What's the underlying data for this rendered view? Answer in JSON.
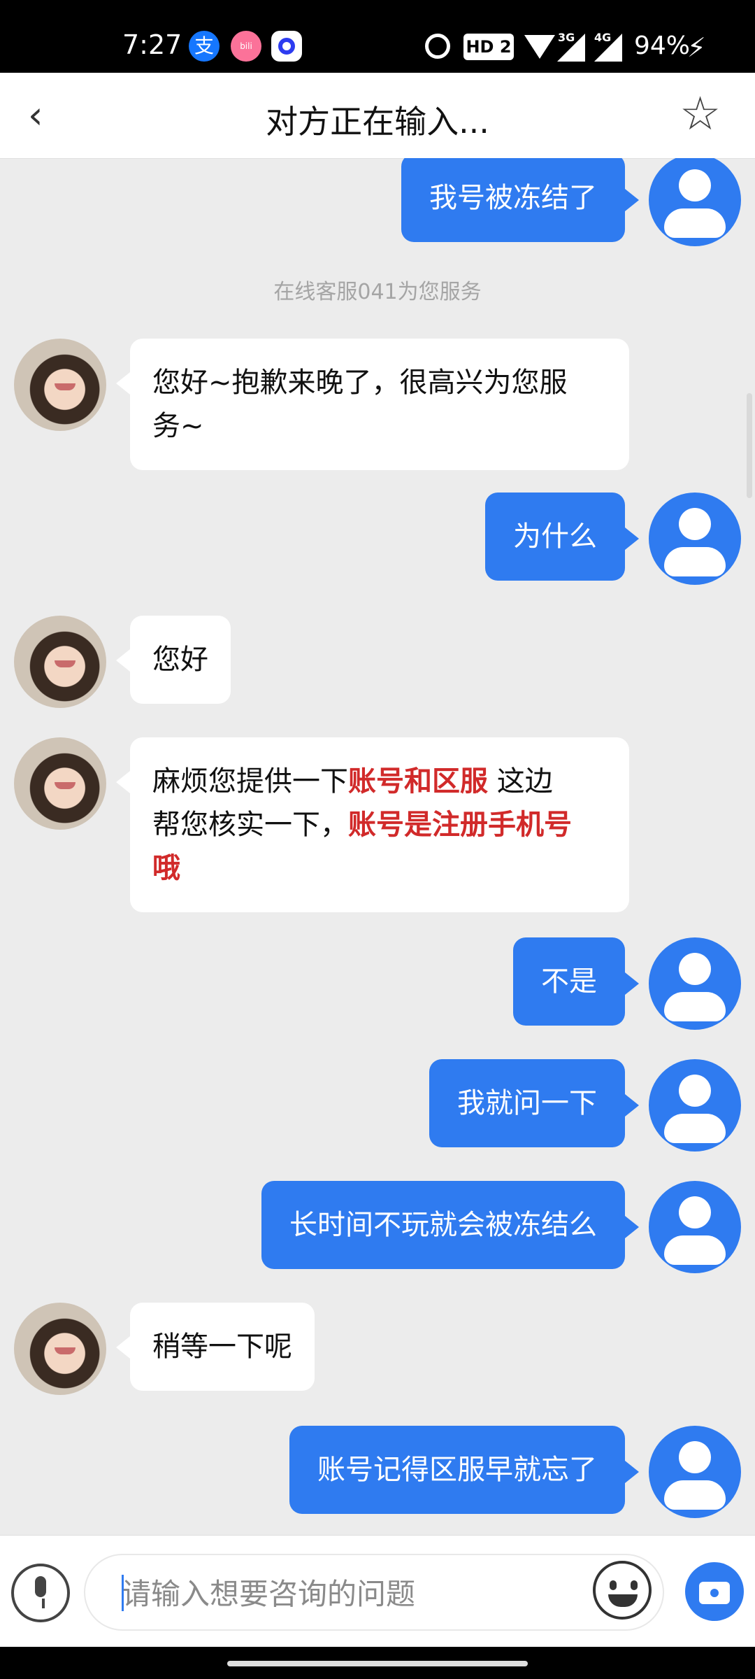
{
  "status_bar": {
    "time": "7:27",
    "hd_badge": "HD 2",
    "net1": "3G",
    "net2": "4G",
    "battery": "94%",
    "icons": [
      "alipay-icon",
      "bilibili-icon",
      "app-icon",
      "alarm-icon",
      "wifi-icon",
      "signal-icon",
      "charging-icon"
    ]
  },
  "header": {
    "title": "对方正在输入...",
    "back_icon": "‹",
    "star_icon": "☆"
  },
  "messages": [
    {
      "from": "user",
      "text": "我号被冻结了"
    },
    {
      "from": "system",
      "text": "在线客服041为您服务"
    },
    {
      "from": "agent",
      "lines": [
        "您好~抱歉来晚了，很高兴为您服",
        "务~"
      ]
    },
    {
      "from": "user",
      "text": "为什么"
    },
    {
      "from": "agent",
      "lines": [
        "您好"
      ]
    },
    {
      "from": "agent",
      "rich": {
        "p1": "麻烦您提供一下",
        "r1": "账号和区服",
        "p2": " 这边",
        "p3": "帮您核实一下，",
        "r2": "账号是注册手机号",
        "r3": "哦"
      }
    },
    {
      "from": "user",
      "text": "不是"
    },
    {
      "from": "user",
      "text": "我就问一下"
    },
    {
      "from": "user",
      "text": "长时间不玩就会被冻结么"
    },
    {
      "from": "agent",
      "lines": [
        "稍等一下呢"
      ]
    },
    {
      "from": "user",
      "text": "账号记得区服早就忘了"
    }
  ],
  "input": {
    "placeholder": "请输入想要咨询的问题"
  },
  "colors": {
    "accent": "#2f7bf0",
    "highlight": "#d12a2a",
    "background": "#ececec"
  }
}
